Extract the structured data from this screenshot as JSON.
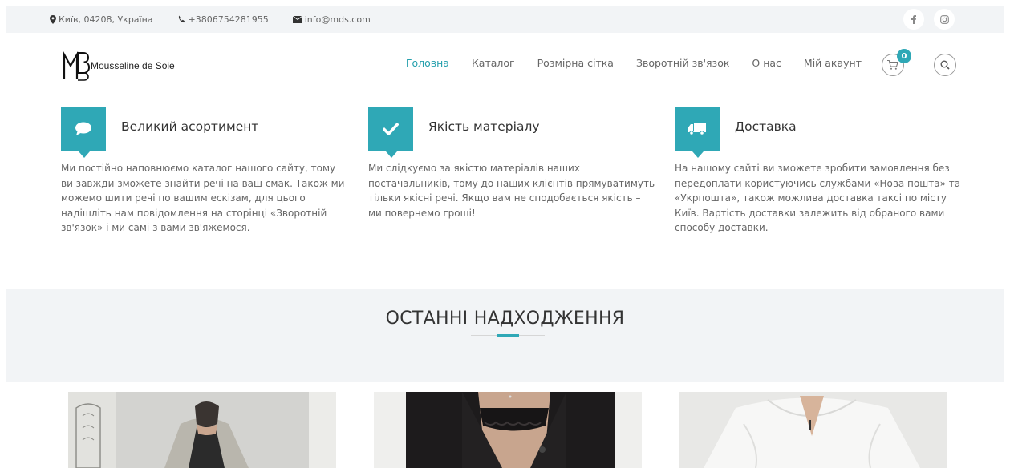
{
  "topbar": {
    "address": "Київ, 04208, Україна",
    "phone": "+3806754281955",
    "email": "info@mds.com",
    "social": [
      {
        "icon": "facebook-icon"
      },
      {
        "icon": "instagram-icon"
      }
    ]
  },
  "header": {
    "logo_text": "Mousseline de Soie",
    "nav": [
      {
        "label": "Головна",
        "active": true
      },
      {
        "label": "Каталог",
        "active": false
      },
      {
        "label": "Розмірна сітка",
        "active": false
      },
      {
        "label": "Зворотній зв'язок",
        "active": false
      },
      {
        "label": "О нас",
        "active": false
      },
      {
        "label": "Мій акаунт",
        "active": false
      }
    ],
    "cart_count": "0"
  },
  "features": [
    {
      "icon": "chat-bubble-icon",
      "title": "Великий асортимент",
      "text": "Ми постійно наповнюємо каталог нашого сайту, тому ви завжди зможете знайти речі на ваш смак. Також ми можемо шити речі по вашим ескізам, для цього надішліть нам повідомлення на сторінці «Зворотній зв'язок» і ми самі з вами зв'яжемося."
    },
    {
      "icon": "check-icon",
      "title": "Якість матеріалу",
      "text": "Ми слідкуємо за якістю матеріалів наших постачальників, тому до наших клієнтів прямуватимуть тільки якісні речі. Якщо вам не сподобається якість – ми повернемо гроші!"
    },
    {
      "icon": "truck-icon",
      "title": "Доставка",
      "text": "На нашому сайті ви зможете зробити замовлення без передоплати користуючись службами «Нова пошта» та «Укрпошта», також можлива доставка таксі по місту Київ. Вартість доставки залежить від обраного вами способу доставки."
    }
  ],
  "latest": {
    "title": "ОСТАННІ НАДХОДЖЕННЯ"
  },
  "colors": {
    "accent": "#2fa8b6",
    "nav_active": "#26a0ad",
    "topbar_bg": "#f2f4f6"
  }
}
